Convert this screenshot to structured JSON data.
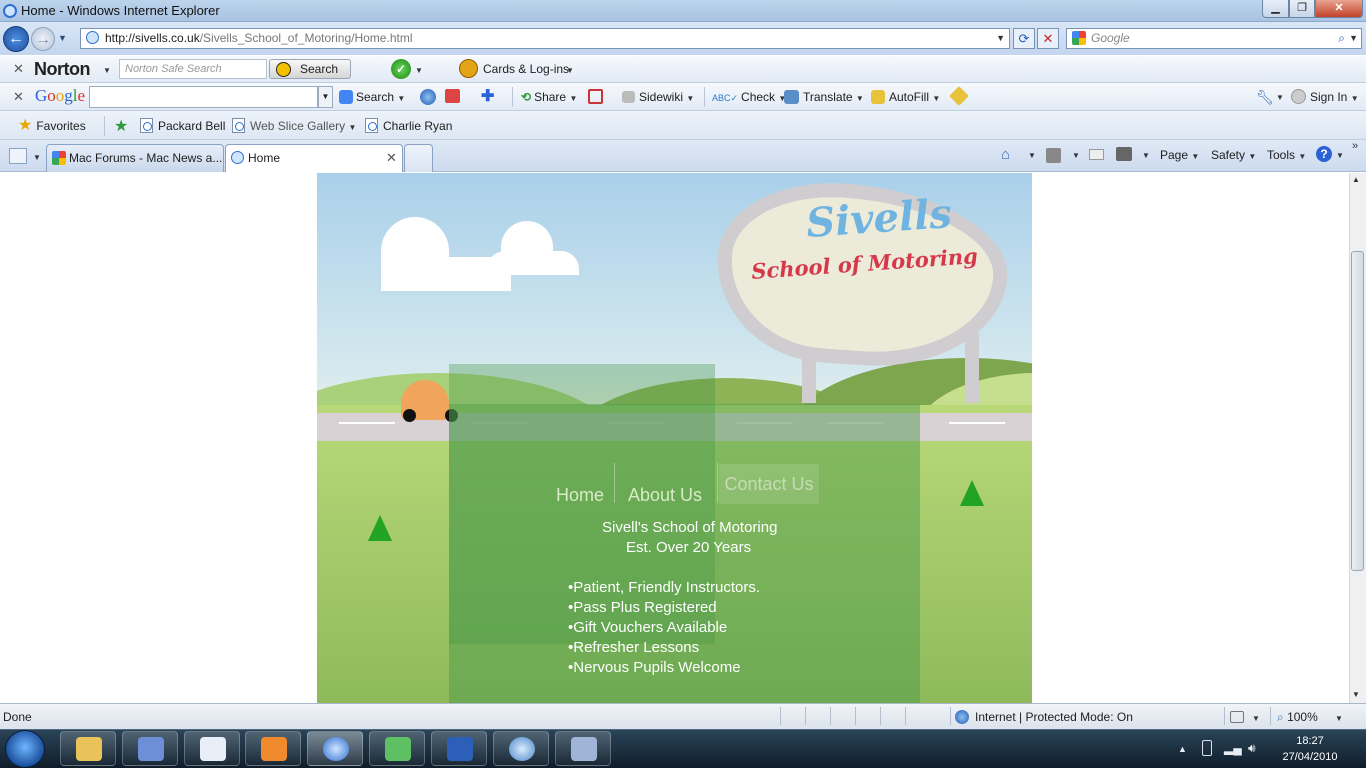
{
  "window": {
    "title": "Home - Windows Internet Explorer"
  },
  "nav": {
    "address_host": "http://sivells.co.uk",
    "address_path": "/Sivells_School_of_Motoring/Home.html",
    "search_placeholder": "Google"
  },
  "norton": {
    "logo": "Norton",
    "search_placeholder": "Norton Safe Search",
    "search_button": "Search",
    "cards_label": "Cards & Log-ins"
  },
  "google_bar": {
    "logo": "Google",
    "search": "Search",
    "share": "Share",
    "sidewiki": "Sidewiki",
    "check": "Check",
    "translate": "Translate",
    "autofill": "AutoFill",
    "sign_in": "Sign In"
  },
  "favorites": {
    "label": "Favorites",
    "items": [
      "Packard Bell",
      "Web Slice Gallery",
      "Charlie Ryan"
    ]
  },
  "tabs": [
    {
      "label": "Mac Forums - Mac News a...",
      "active": false
    },
    {
      "label": "Home",
      "active": true
    }
  ],
  "command_bar": {
    "page": "Page",
    "safety": "Safety",
    "tools": "Tools"
  },
  "site": {
    "sign_title": "Sivells",
    "sign_subtitle": "School of Motoring",
    "nav": [
      "Home",
      "About Us",
      "Contact Us"
    ],
    "heading": "Sivell's School of Motoring",
    "subheading": "Est. Over 20 Years",
    "bullets": [
      "•Patient, Friendly Instructors.",
      "•Pass Plus Registered",
      "•Gift Vouchers Available",
      "•Refresher Lessons",
      "•Nervous Pupils Welcome"
    ]
  },
  "status": {
    "text": "Done",
    "zone": "Internet | Protected Mode: On",
    "zoom": "100%"
  },
  "taskbar": {
    "time": "18:27",
    "date": "27/04/2010"
  },
  "colors": {
    "accent": "#2f6fd1",
    "site_green": "#8eba5c",
    "sign_blue": "#6fb3e0",
    "sign_red": "#d6384a"
  }
}
